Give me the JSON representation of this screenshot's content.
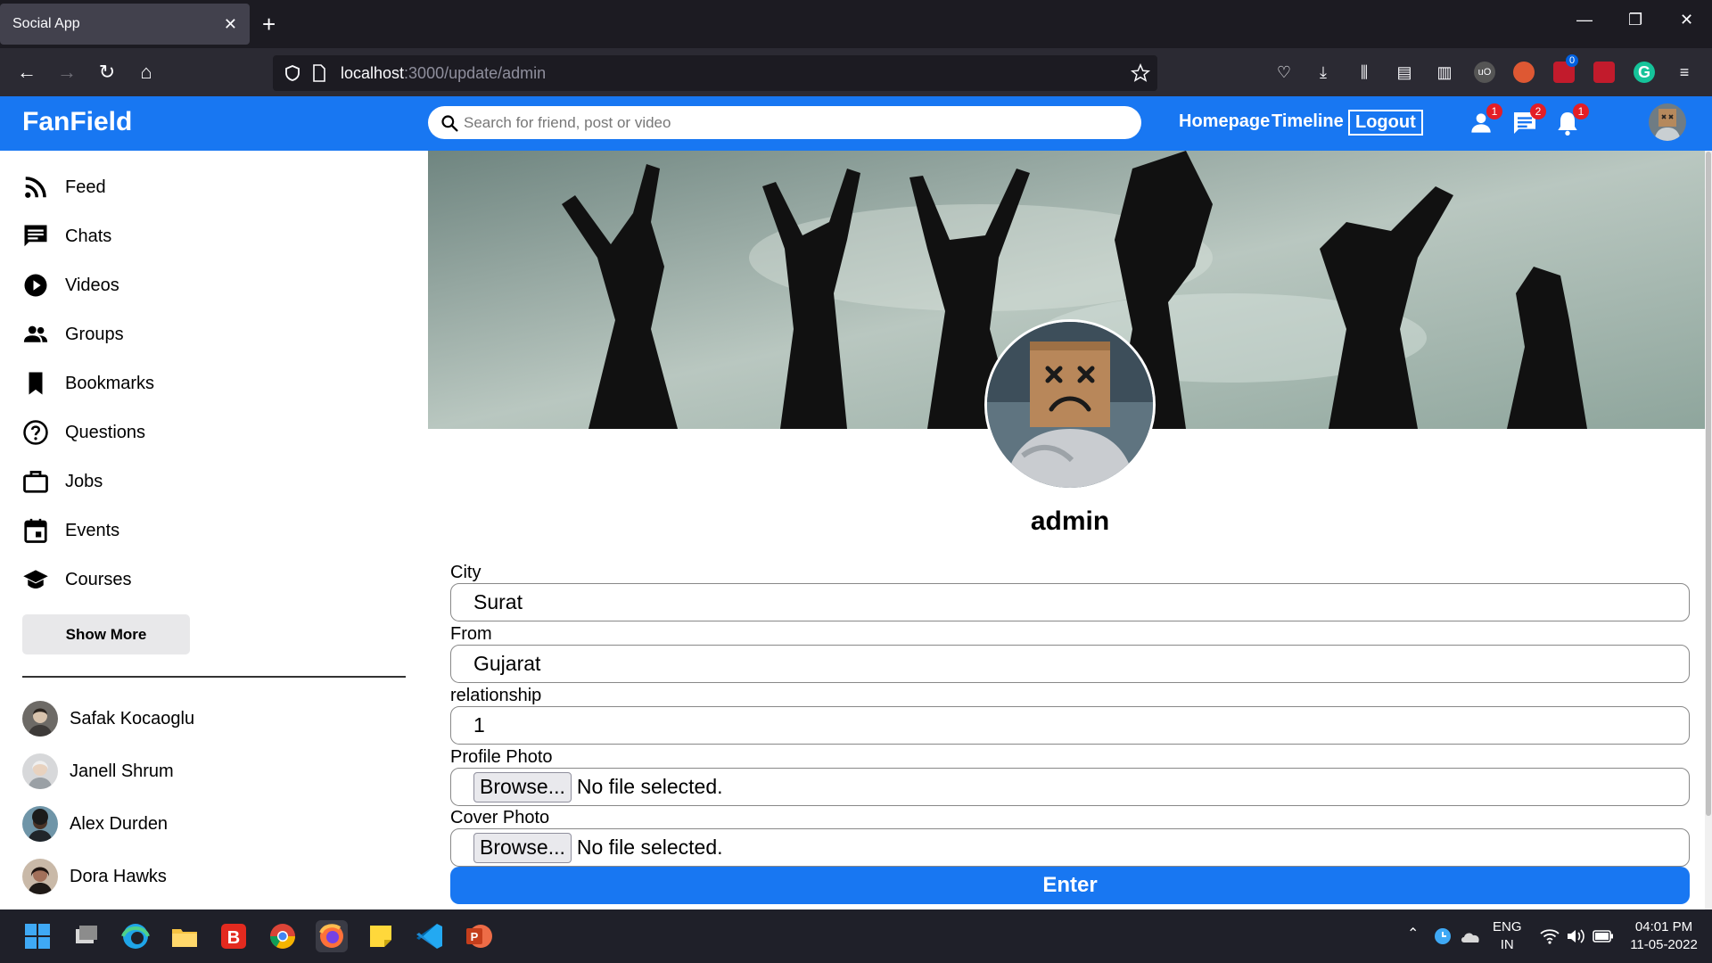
{
  "browser": {
    "tab_title": "Social App",
    "url_host": "localhost",
    "url_path": ":3000/update/admin",
    "ext_badge": "0"
  },
  "header": {
    "logo": "FanField",
    "search_placeholder": "Search for friend, post or video",
    "links": {
      "homepage": "Homepage",
      "timeline": "Timeline",
      "logout": "Logout"
    },
    "badges": {
      "friends": "1",
      "messages": "2",
      "notifications": "1"
    },
    "brand_color": "#1877f2"
  },
  "sidebar": {
    "items": [
      {
        "label": "Feed",
        "icon": "rss-feed-icon"
      },
      {
        "label": "Chats",
        "icon": "chat-icon"
      },
      {
        "label": "Videos",
        "icon": "play-circle-icon"
      },
      {
        "label": "Groups",
        "icon": "group-icon"
      },
      {
        "label": "Bookmarks",
        "icon": "bookmark-icon"
      },
      {
        "label": "Questions",
        "icon": "help-circle-icon"
      },
      {
        "label": "Jobs",
        "icon": "briefcase-icon"
      },
      {
        "label": "Events",
        "icon": "calendar-icon"
      },
      {
        "label": "Courses",
        "icon": "school-icon"
      }
    ],
    "show_more": "Show More",
    "friends": [
      {
        "name": "Safak Kocaoglu"
      },
      {
        "name": "Janell Shrum"
      },
      {
        "name": "Alex Durden"
      },
      {
        "name": "Dora Hawks"
      }
    ]
  },
  "profile": {
    "username": "admin"
  },
  "form": {
    "city": {
      "label": "City",
      "value": "Surat"
    },
    "from": {
      "label": "From",
      "value": "Gujarat"
    },
    "relationship": {
      "label": "relationship",
      "value": "1"
    },
    "profile_photo": {
      "label": "Profile Photo",
      "button": "Browse...",
      "status": "No file selected."
    },
    "cover_photo": {
      "label": "Cover Photo",
      "button": "Browse...",
      "status": "No file selected."
    },
    "submit": "Enter"
  },
  "taskbar": {
    "lang": "ENG",
    "region": "IN",
    "time": "04:01 PM",
    "date": "11-05-2022"
  }
}
